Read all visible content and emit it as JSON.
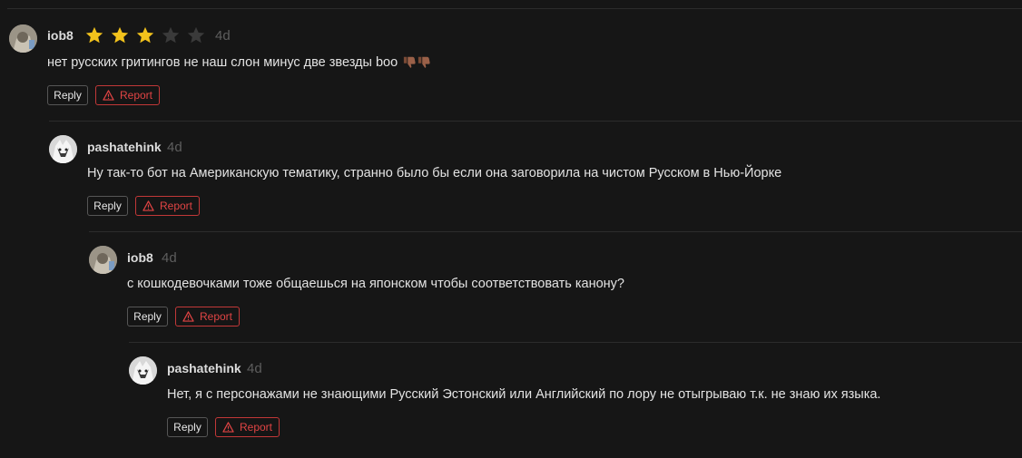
{
  "comments": [
    {
      "username": "iob8",
      "time": "4d",
      "rating": 3,
      "rating_max": 5,
      "text": "нет русских гритингов не наш слон минус две звезды boo",
      "reaction_icons": [
        "thumbs-down-icon",
        "thumbs-down-icon"
      ],
      "reply_label": "Reply",
      "report_label": "Report"
    },
    {
      "username": "pashatehink",
      "time": "4d",
      "text": "Ну так-то бот на Американскую тематику, странно было бы если она заговорила на чистом Русском в Нью-Йорке",
      "reply_label": "Reply",
      "report_label": "Report"
    },
    {
      "username": "iob8",
      "time": "4d",
      "text": "с кошкодевочками тоже общаешься на японском чтобы соответствовать канону?",
      "reply_label": "Reply",
      "report_label": "Report"
    },
    {
      "username": "pashatehink",
      "time": "4d",
      "text": "Нет, я с персонажами не знающими Русский Эстонский или Английский по лору не отыгрываю т.к. не знаю их языка.",
      "reply_label": "Reply",
      "report_label": "Report"
    }
  ],
  "colors": {
    "background": "#161616",
    "star_filled": "#f2c21c",
    "star_empty": "#3a3a3a",
    "report": "#e04444"
  }
}
